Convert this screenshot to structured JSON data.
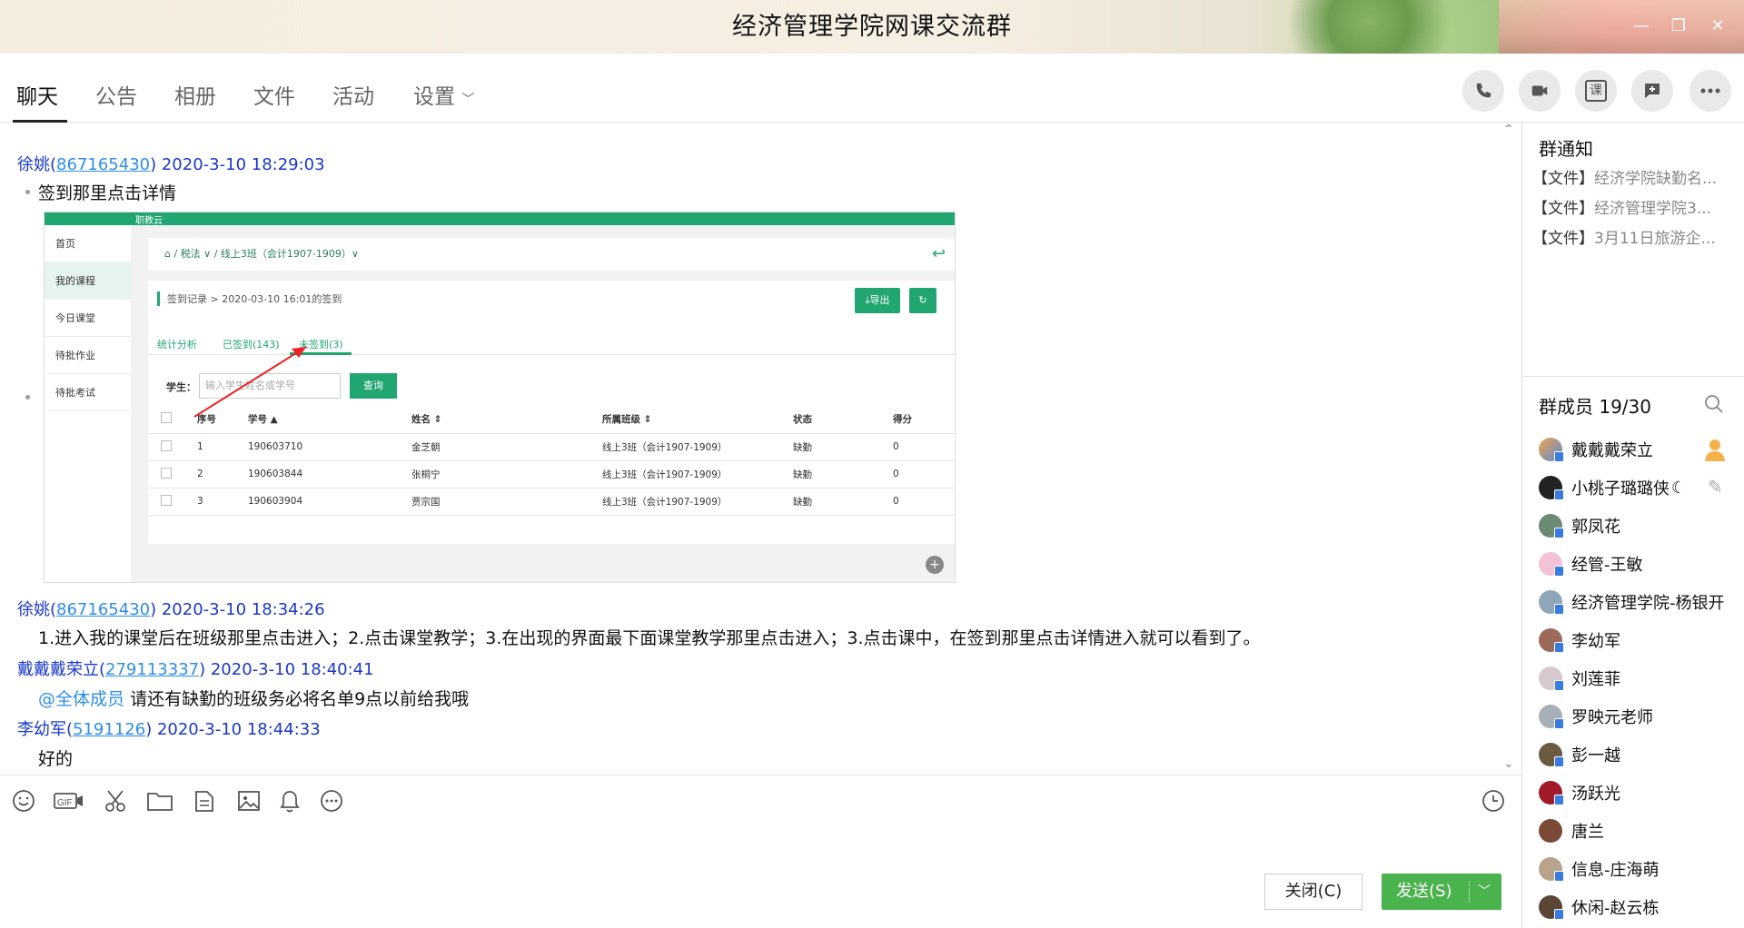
{
  "window": {
    "title": "经济管理学院网课交流群"
  },
  "tabs": [
    "聊天",
    "公告",
    "相册",
    "文件",
    "活动",
    "设置"
  ],
  "right_actions": [
    "phone-icon",
    "video-icon",
    "course-icon",
    "add-topic-icon",
    "more-icon"
  ],
  "right_action_course_label": "课",
  "messages": [
    {
      "sender": "徐姚",
      "uid": "867165430",
      "time": "2020-3-10 18:29:03",
      "text": "签到那里点击详情"
    },
    {
      "sender": "徐姚",
      "uid": "867165430",
      "time": "2020-3-10 18:34:26",
      "text": "1.进入我的课堂后在班级那里点击进入；2.点击课堂教学；3.在出现的界面最下面课堂教学那里点击进入；3.点击课中，在签到那里点击详情进入就可以看到了。"
    },
    {
      "sender": "戴戴戴荣立",
      "uid": "279113337",
      "time": "2020-3-10 18:40:41",
      "mention": "@全体成员",
      "text": "请还有缺勤的班级务必将名单9点以前给我哦"
    },
    {
      "sender": "李幼军",
      "uid": "5191126",
      "time": "2020-3-10 18:44:33",
      "text": "好的"
    }
  ],
  "screenshot": {
    "brand": "职教云",
    "side_menu": [
      "首页",
      "我的课程",
      "今日课堂",
      "待批作业",
      "待批考试"
    ],
    "breadcrumb": "/ 税法 ∨ / 线上3班（会计1907-1909）∨",
    "crumb": "签到记录  >  2020-03-10 16:01的签到",
    "export_label": "导出",
    "tabs": [
      "统计分析",
      "已签到(143)",
      "未签到(3)"
    ],
    "student_label": "学生：",
    "search_placeholder": "输入学生姓名或学号",
    "query_label": "查询",
    "columns": [
      "序号",
      "学号 ▲",
      "姓名 ⇕",
      "所属班级 ⇕",
      "状态",
      "得分"
    ],
    "rows": [
      [
        "1",
        "190603710",
        "金芝朝",
        "线上3班（会计1907-1909）",
        "缺勤",
        "0"
      ],
      [
        "2",
        "190603844",
        "张桐宁",
        "线上3班（会计1907-1909）",
        "缺勤",
        "0"
      ],
      [
        "3",
        "190603904",
        "贾宗国",
        "线上3班（会计1907-1909）",
        "缺勤",
        "0"
      ]
    ]
  },
  "notice": {
    "title": "群通知",
    "items": [
      {
        "tag": "【文件】",
        "name": "经济学院缺勤名..."
      },
      {
        "tag": "【文件】",
        "name": "经济管理学院3..."
      },
      {
        "tag": "【文件】",
        "name": "3月11日旅游企..."
      }
    ]
  },
  "members": {
    "title": "群成员 19/30",
    "list": [
      "戴戴戴荣立",
      "小桃子璐璐侠",
      "郭凤花",
      "经管-王敏",
      "经济管理学院-杨银开",
      "李幼军",
      "刘莲菲",
      "罗映元老师",
      "彭一越",
      "汤跃光",
      "唐兰",
      "信息-庄海萌",
      "休闲-赵云栋"
    ]
  },
  "input_toolbar": [
    "emoji-icon",
    "gif-icon",
    "scissors-icon",
    "folder-icon",
    "doc-icon",
    "image-icon",
    "bell-icon",
    "more-circle-icon"
  ],
  "buttons": {
    "close": "关闭(C)",
    "send": "发送(S)"
  },
  "colors": {
    "sender": "#1a37c8",
    "uid": "#2d8ee8",
    "send": "#4ab34e",
    "accent_green": "#21a672"
  }
}
